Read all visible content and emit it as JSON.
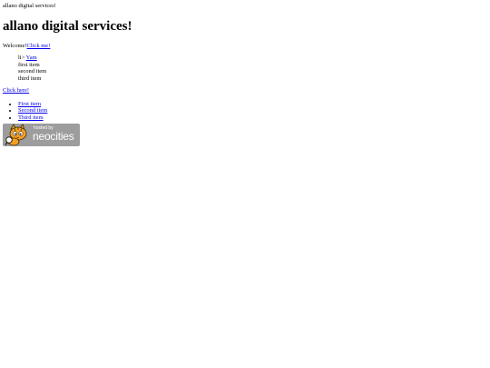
{
  "header": {
    "small_title": "allano digital services!"
  },
  "main": {
    "heading": "allano digital services!",
    "welcome_text": "Welcome!",
    "welcome_link": "Click me!",
    "list1": {
      "li_prefix": "li>",
      "li_link": "Yam",
      "items": [
        "first item",
        "second item",
        "third item"
      ]
    },
    "click_here_link": "Click here!",
    "list2": {
      "items": [
        "First item",
        "Second item",
        "Third item"
      ]
    }
  },
  "badge": {
    "hosted_by": "hosted by",
    "brand": "neocities",
    "icon": "neocities-cat-icon",
    "colors": {
      "bg": "#9d9d9d",
      "cat_body": "#f6a021"
    }
  }
}
